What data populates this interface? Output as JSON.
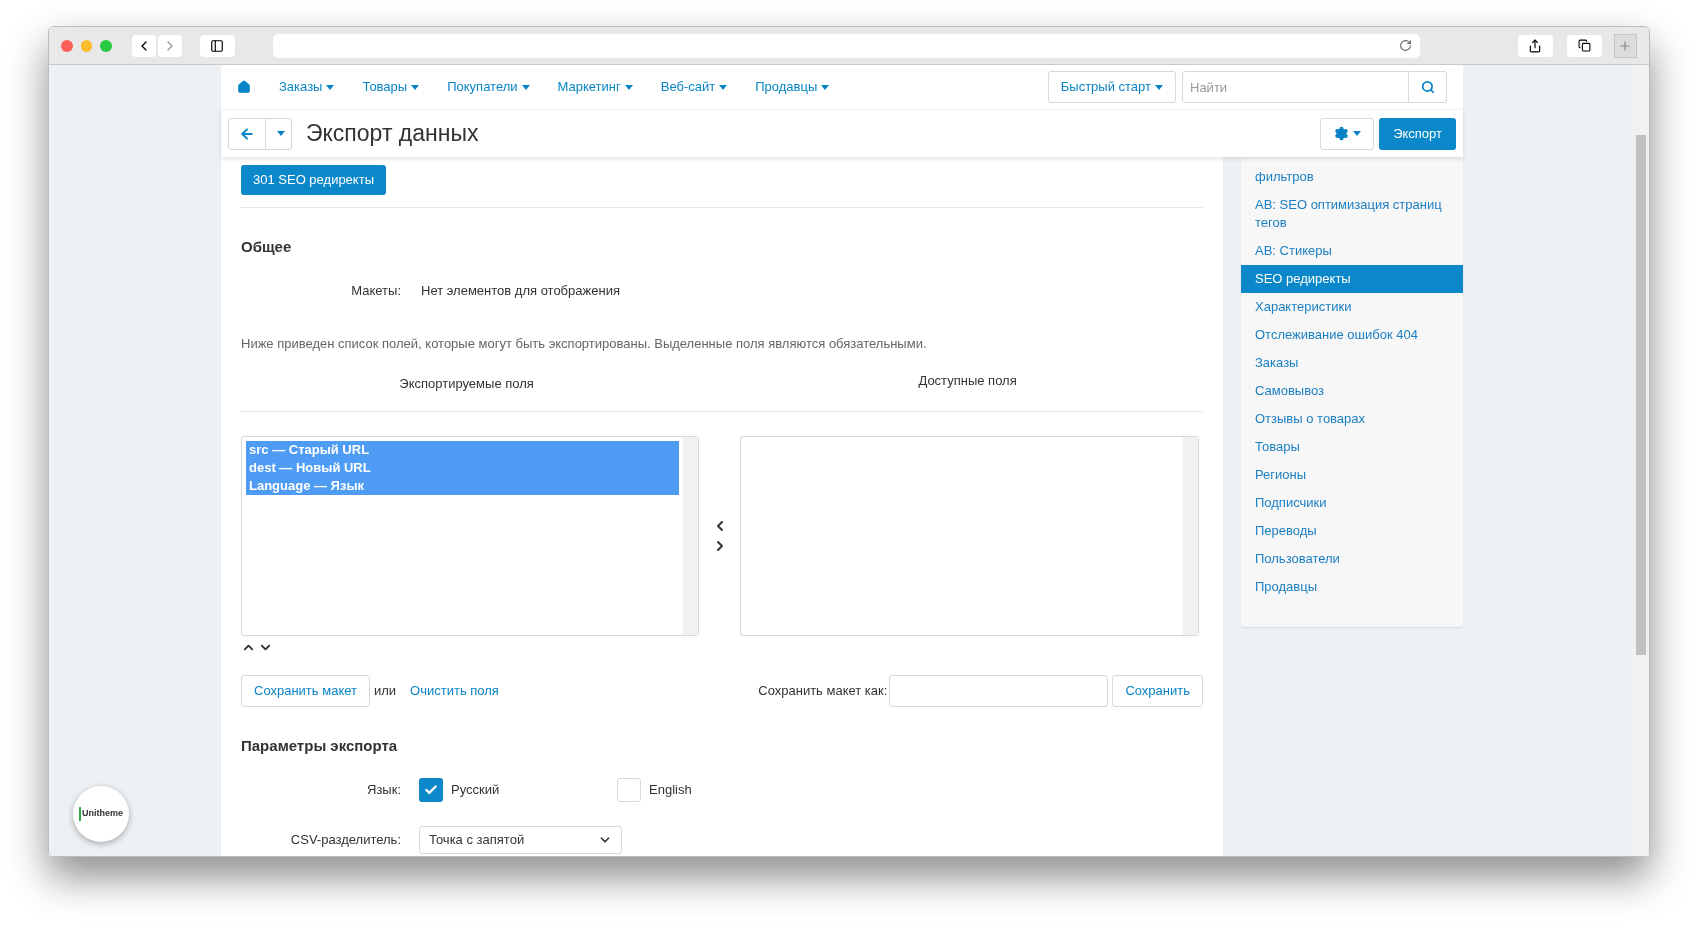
{
  "nav": {
    "items": [
      "Заказы",
      "Товары",
      "Покупатели",
      "Маркетинг",
      "Веб-сайт",
      "Продавцы"
    ],
    "quick_start": "Быстрый старт",
    "search": {
      "placeholder": "Найти"
    }
  },
  "page": {
    "title": "Экспорт данных",
    "export_button": "Экспорт"
  },
  "section_button": "301 SEO редиректы",
  "general": {
    "heading": "Общее",
    "layouts_label": "Макеты:",
    "layouts_value": "Нет элементов для отображения"
  },
  "fields": {
    "note": "Ниже приведен список полей, которые могут быть экспортированы. Выделенные поля являются обязательными.",
    "exported_heading": "Экспортируемые поля",
    "available_heading": "Доступные поля",
    "exported": [
      {
        "text": "src — Старый URL",
        "selected": true
      },
      {
        "text": "dest — Новый URL",
        "selected": true
      },
      {
        "text": "Language — Язык",
        "selected": true
      }
    ]
  },
  "layout_actions": {
    "save_layout": "Сохранить макет",
    "or": "или",
    "clear": "Очистить поля",
    "save_as_label": "Сохранить макет как:",
    "save": "Сохранить"
  },
  "export_params": {
    "heading": "Параметры экспорта",
    "language_label": "Язык:",
    "languages": [
      {
        "label": "Русский",
        "checked": true
      },
      {
        "label": "English",
        "checked": false
      }
    ],
    "csv_label": "CSV-разделитель:",
    "csv_value": "Точка с запятой"
  },
  "sidebar": {
    "items": [
      {
        "label": "фильтров",
        "selected": false
      },
      {
        "label": "AB: SEO оптимизация страниц тегов",
        "selected": false
      },
      {
        "label": "AB: Стикеры",
        "selected": false
      },
      {
        "label": "SEO редиректы",
        "selected": true
      },
      {
        "label": "Характеристики",
        "selected": false
      },
      {
        "label": "Отслеживание ошибок 404",
        "selected": false
      },
      {
        "label": "Заказы",
        "selected": false
      },
      {
        "label": "Самовывоз",
        "selected": false
      },
      {
        "label": "Отзывы о товарах",
        "selected": false
      },
      {
        "label": "Товары",
        "selected": false
      },
      {
        "label": "Регионы",
        "selected": false
      },
      {
        "label": "Подписчики",
        "selected": false
      },
      {
        "label": "Переводы",
        "selected": false
      },
      {
        "label": "Пользователи",
        "selected": false
      },
      {
        "label": "Продавцы",
        "selected": false
      }
    ]
  },
  "badge": "Unitheme"
}
